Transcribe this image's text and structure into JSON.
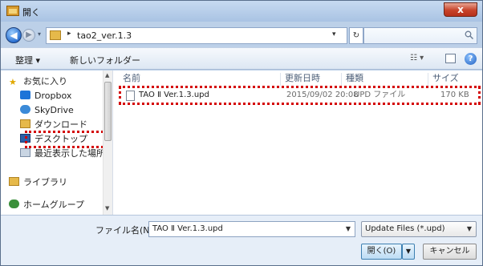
{
  "window": {
    "title": "開く",
    "close_glyph": "x"
  },
  "address": {
    "path": "tao2_ver.1.3",
    "separator": "▸",
    "dropdown_glyph": "▾",
    "refresh_glyph": "↻",
    "search_placeholder": ""
  },
  "toolbar": {
    "organize_label": "整理 ▾",
    "new_folder_label": "新しいフォルダー",
    "view_glyph": "☷ ▾",
    "help_glyph": "?"
  },
  "nav": {
    "items": [
      {
        "label": "お気に入り",
        "icon": "star-icon"
      },
      {
        "label": "Dropbox",
        "icon": "dropbox-icon"
      },
      {
        "label": "SkyDrive",
        "icon": "cloud-icon"
      },
      {
        "label": "ダウンロード",
        "icon": "download-folder-icon"
      },
      {
        "label": "デスクトップ",
        "icon": "desktop-icon"
      },
      {
        "label": "最近表示した場所",
        "icon": "recent-places-icon"
      },
      {
        "label": "ライブラリ",
        "icon": "library-icon"
      },
      {
        "label": "ホームグループ",
        "icon": "homegroup-icon"
      }
    ],
    "scroll_up_glyph": "▲",
    "scroll_down_glyph": "▼"
  },
  "list": {
    "columns": [
      "名前",
      "更新日時",
      "種類",
      "サイズ"
    ],
    "files": [
      {
        "name": "TAO Ⅱ Ver.1.3.upd",
        "modified": "2015/09/02 20:08",
        "type": "UPD ファイル",
        "size": "170 KB"
      }
    ]
  },
  "bottom": {
    "filename_label": "ファイル名(N):",
    "filename_value": "TAO Ⅱ Ver.1.3.upd",
    "filter_value": "Update Files (*.upd)",
    "open_label": "開く(O)",
    "cancel_label": "キャンセル",
    "dropdown_glyph": "▼"
  },
  "colors": {
    "highlight": "#d40000",
    "accent": "#1f5fc0"
  }
}
